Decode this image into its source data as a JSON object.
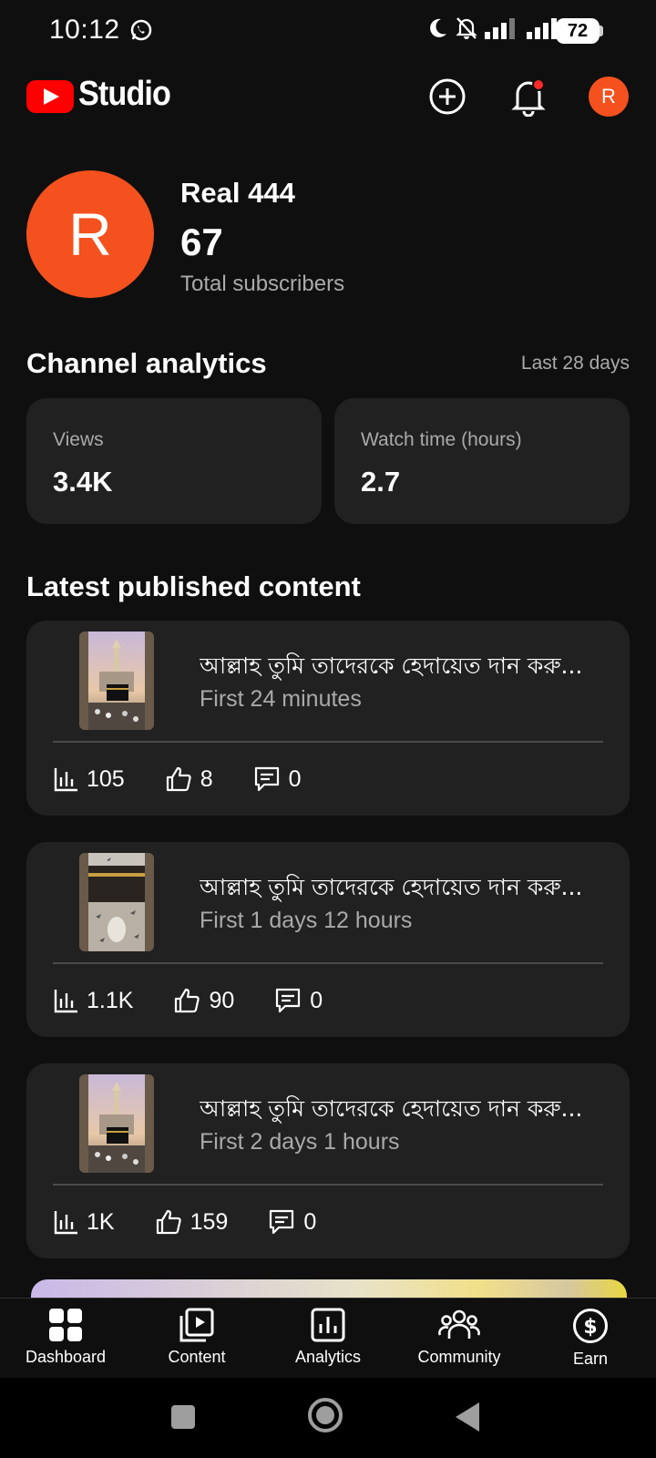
{
  "status_bar": {
    "time": "10:12",
    "battery": "72"
  },
  "header": {
    "app_title": "Studio",
    "avatar_letter": "R"
  },
  "channel": {
    "avatar_letter": "R",
    "name": "Real 444",
    "subscribers": "67",
    "subscribers_label": "Total subscribers"
  },
  "analytics": {
    "title": "Channel analytics",
    "period": "Last 28 days",
    "cards": [
      {
        "label": "Views",
        "value": "3.4K"
      },
      {
        "label": "Watch time (hours)",
        "value": "2.7"
      }
    ]
  },
  "latest": {
    "title": "Latest published content",
    "items": [
      {
        "title": "আল্লাহ তুমি তাদেরকে হেদায়েত দান করু...",
        "subtitle": "First 24 minutes",
        "views": "105",
        "likes": "8",
        "comments": "0"
      },
      {
        "title": "আল্লাহ তুমি তাদেরকে হেদায়েত দান করু...",
        "subtitle": "First 1 days 12 hours",
        "views": "1.1K",
        "likes": "90",
        "comments": "0"
      },
      {
        "title": "আল্লাহ তুমি তাদেরকে হেদায়েত দান করু...",
        "subtitle": "First 2 days 1 hours",
        "views": "1K",
        "likes": "159",
        "comments": "0"
      }
    ]
  },
  "bottom_nav": {
    "items": [
      {
        "label": "Dashboard",
        "icon": "dashboard-icon"
      },
      {
        "label": "Content",
        "icon": "content-icon"
      },
      {
        "label": "Analytics",
        "icon": "analytics-icon"
      },
      {
        "label": "Community",
        "icon": "community-icon"
      },
      {
        "label": "Earn",
        "icon": "dollar-icon"
      }
    ]
  },
  "colors": {
    "brand_red": "#ff0000",
    "avatar_orange": "#f4511e",
    "card_bg": "#212121",
    "background": "#0f0f0f"
  }
}
